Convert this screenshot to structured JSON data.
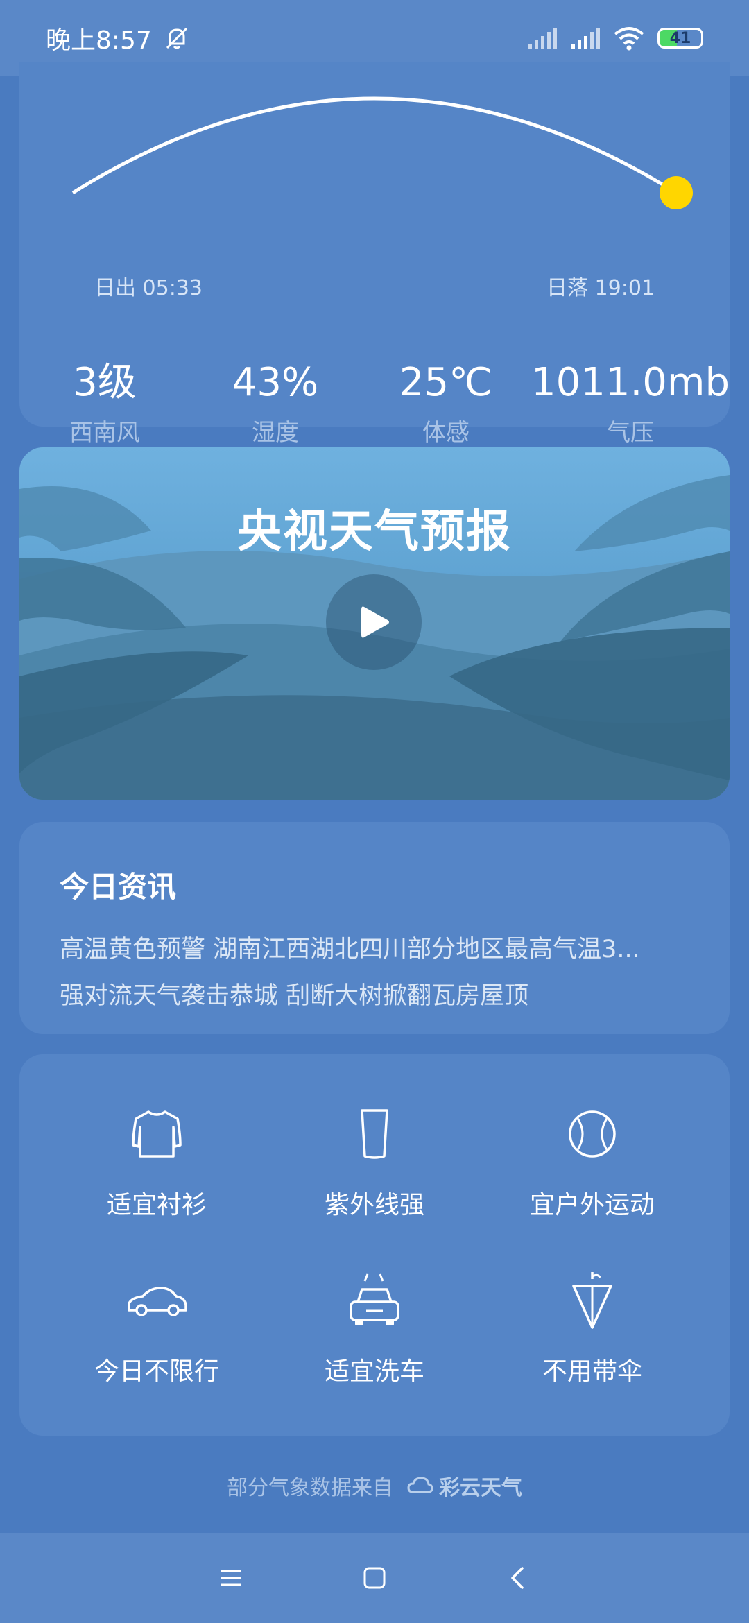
{
  "status": {
    "time": "晚上8:57",
    "battery": "41",
    "battery_level": 0.41
  },
  "sun": {
    "sunrise": "日出 05:33",
    "sunset": "日落 19:01",
    "progress": 1.0
  },
  "stats": [
    {
      "value": "3级",
      "label": "西南风"
    },
    {
      "value": "43%",
      "label": "湿度"
    },
    {
      "value": "25℃",
      "label": "体感"
    },
    {
      "value": "1011.0mb",
      "label": "气压"
    }
  ],
  "video": {
    "title": "央视天气预报"
  },
  "news": {
    "title": "今日资讯",
    "items": [
      "高温黄色预警 湖南江西湖北四川部分地区最高气温3...",
      "强对流天气袭击恭城 刮断大树掀翻瓦房屋顶"
    ]
  },
  "tips": [
    {
      "label": "适宜衬衫",
      "icon": "shirt-icon"
    },
    {
      "label": "紫外线强",
      "icon": "cup-icon"
    },
    {
      "label": "宜户外运动",
      "icon": "ball-icon"
    },
    {
      "label": "今日不限行",
      "icon": "car-icon"
    },
    {
      "label": "适宜洗车",
      "icon": "car-wash-icon"
    },
    {
      "label": "不用带伞",
      "icon": "umbrella-icon"
    }
  ],
  "footer": {
    "source": "部分气象数据来自",
    "brand": "彩云天气"
  },
  "colors": {
    "background": "#4a7bc0",
    "card": "#5585c7",
    "sun": "#ffd600"
  }
}
